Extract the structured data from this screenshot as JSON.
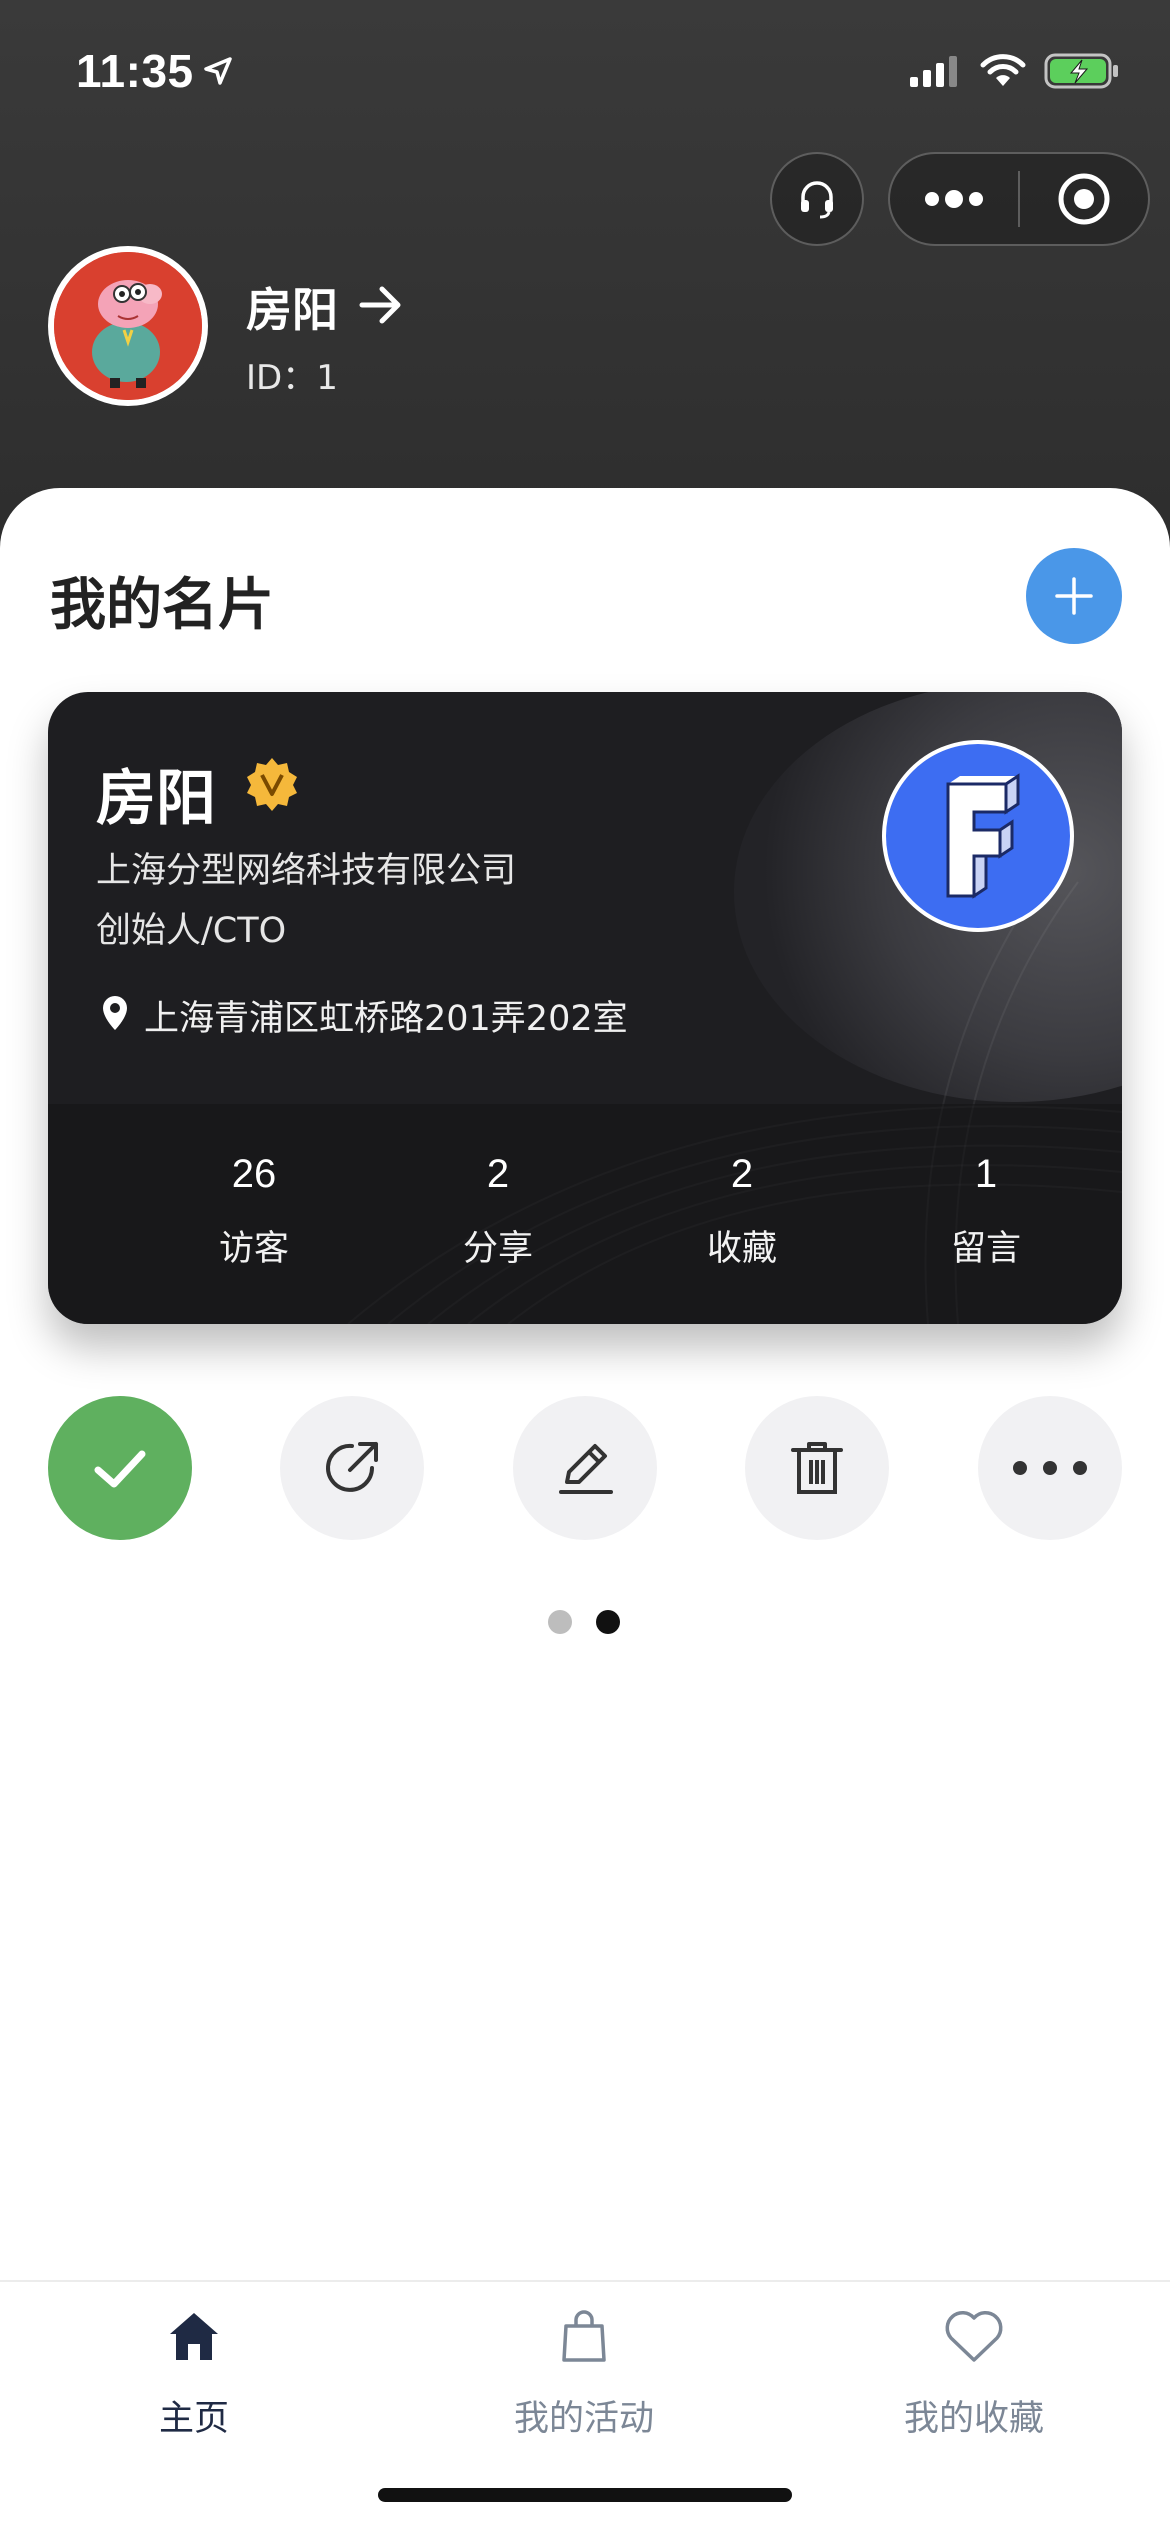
{
  "status_bar": {
    "time": "11:35"
  },
  "profile": {
    "name": "房阳",
    "id_text": "ID：1"
  },
  "section": {
    "title": "我的名片"
  },
  "card": {
    "name": "房阳",
    "company": "上海分型网络科技有限公司",
    "job_title": "创始人/CTO",
    "address": "上海青浦区虹桥路201弄202室",
    "stats": [
      {
        "value": "26",
        "label": "访客"
      },
      {
        "value": "2",
        "label": "分享"
      },
      {
        "value": "2",
        "label": "收藏"
      },
      {
        "value": "1",
        "label": "留言"
      }
    ]
  },
  "actions": [
    "check-icon",
    "share-icon",
    "edit-icon",
    "trash-icon",
    "more-icon"
  ],
  "pager": {
    "count": 2,
    "active_index": 1
  },
  "tabs": [
    {
      "label": "主页",
      "icon": "home-icon",
      "active": true
    },
    {
      "label": "我的活动",
      "icon": "bag-icon",
      "active": false
    },
    {
      "label": "我的收藏",
      "icon": "heart-icon",
      "active": false
    }
  ],
  "colors": {
    "accent_blue": "#4a97e8",
    "confirm_green": "#5fb05f",
    "badge_gold": "#f5b83b",
    "logo_blue": "#3d6df2",
    "tab_active": "#1f2a44",
    "tab_inactive": "#7c8796"
  }
}
